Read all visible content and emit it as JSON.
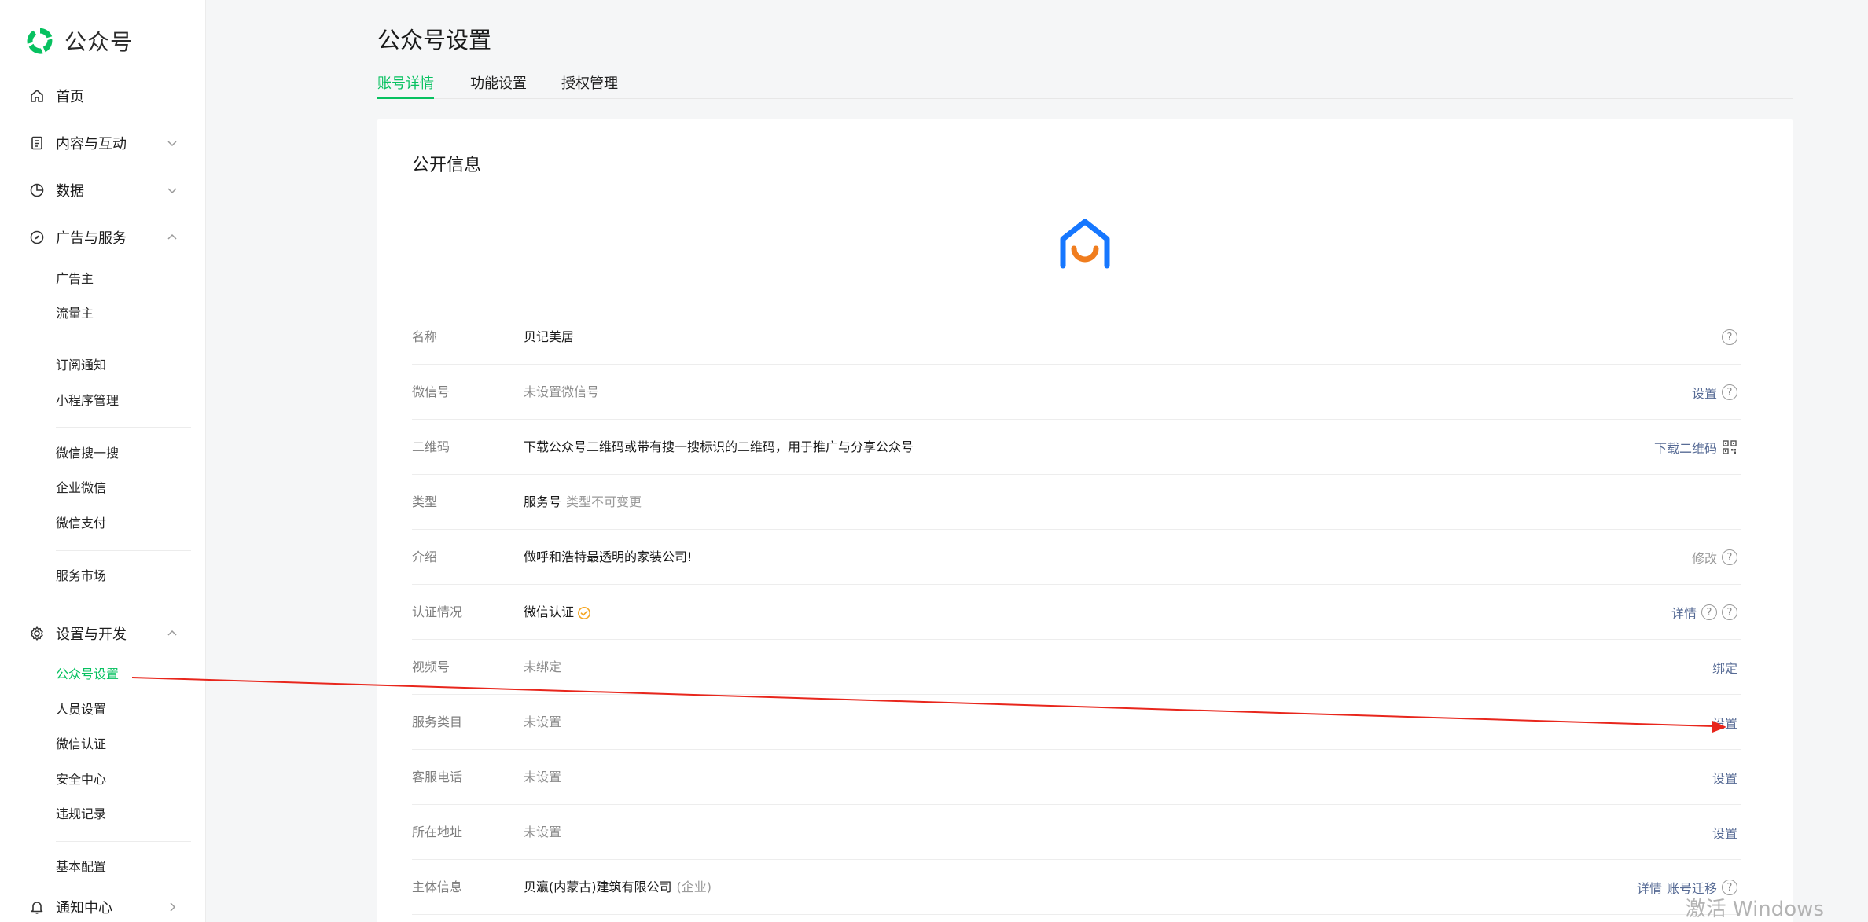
{
  "sidebar": {
    "brand": "公众号",
    "home": "首页",
    "content": "内容与互动",
    "data": "数据",
    "ads": "广告与服务",
    "ads_items": [
      "广告主",
      "流量主"
    ],
    "group2": [
      "订阅通知",
      "小程序管理"
    ],
    "group3": [
      "微信搜一搜",
      "企业微信",
      "微信支付"
    ],
    "group4": [
      "服务市场"
    ],
    "settings": "设置与开发",
    "settings_items": [
      "公众号设置",
      "人员设置",
      "微信认证",
      "安全中心",
      "违规记录"
    ],
    "settings_items2": [
      "基本配置"
    ],
    "notify": "通知中心"
  },
  "page": {
    "title": "公众号设置",
    "tabs": [
      "账号详情",
      "功能设置",
      "授权管理"
    ]
  },
  "card": {
    "section_title": "公开信息",
    "rows": [
      {
        "label": "名称",
        "value": "贝记美居"
      },
      {
        "label": "微信号",
        "value": "未设置微信号",
        "action": "设置"
      },
      {
        "label": "二维码",
        "value": "下载公众号二维码或带有搜一搜标识的二维码，用于推广与分享公众号",
        "action": "下载二维码"
      },
      {
        "label": "类型",
        "value": "服务号",
        "note": "类型不可变更"
      },
      {
        "label": "介绍",
        "value": "做呼和浩特最透明的家装公司!",
        "action": "修改"
      },
      {
        "label": "认证情况",
        "value": "微信认证",
        "action": "详情"
      },
      {
        "label": "视频号",
        "value": "未绑定",
        "action": "绑定"
      },
      {
        "label": "服务类目",
        "value": "未设置",
        "action": "设置"
      },
      {
        "label": "客服电话",
        "value": "未设置",
        "action": "设置"
      },
      {
        "label": "所在地址",
        "value": "未设置",
        "action": "设置"
      },
      {
        "label": "主体信息",
        "value": "贝瀛(内蒙古)建筑有限公司",
        "note": "(企业)",
        "action": "详情",
        "action2": "账号迁移"
      }
    ]
  },
  "watermark": "激活 Windows",
  "colors": {
    "accent": "#07c160",
    "link": "#576b95",
    "annotation": "#e8261c"
  }
}
